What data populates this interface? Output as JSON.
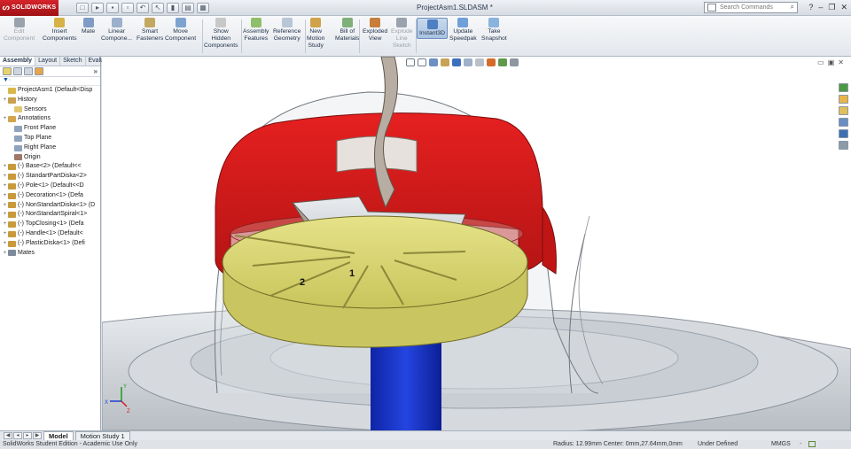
{
  "app": {
    "logo_text": "SOLIDWORKS",
    "doc_title": "ProjectAsm1.SLDASM *"
  },
  "search": {
    "placeholder": "Search Commands"
  },
  "ribbon": {
    "buttons": [
      {
        "label": "Edit\nComponent",
        "state": "disabled"
      },
      {
        "label": "Insert\nComponents",
        "state": "normal"
      },
      {
        "label": "Mate",
        "state": "normal"
      },
      {
        "label": "Linear\nCompone...",
        "state": "normal"
      },
      {
        "label": "Smart\nFasteners",
        "state": "normal"
      },
      {
        "label": "Move\nComponent",
        "state": "normal"
      },
      {
        "label": "Show\nHidden\nComponents",
        "state": "normal"
      },
      {
        "label": "Assembly\nFeatures",
        "state": "normal"
      },
      {
        "label": "Reference\nGeometry",
        "state": "normal"
      },
      {
        "label": "New\nMotion\nStudy",
        "state": "normal"
      },
      {
        "label": "Bill of\nMaterials",
        "state": "normal"
      },
      {
        "label": "Exploded\nView",
        "state": "normal"
      },
      {
        "label": "Explode\nLine\nSketch",
        "state": "disabled"
      },
      {
        "label": "Instant3D",
        "state": "active"
      },
      {
        "label": "Update\nSpeedpak",
        "state": "normal"
      },
      {
        "label": "Take\nSnapshot",
        "state": "normal"
      }
    ]
  },
  "panel": {
    "tabs": [
      "Assembly",
      "Layout",
      "Sketch",
      "Evaluate"
    ],
    "active_tab": "Assembly",
    "tree": [
      {
        "label": "ProjectAsm1  (Default<Disp",
        "level": 0,
        "icon": "assembly-icon",
        "expander": ""
      },
      {
        "label": "History",
        "level": 1,
        "icon": "history-icon",
        "expander": "+"
      },
      {
        "label": "Sensors",
        "level": 1,
        "icon": "sensors-folder-icon",
        "expander": ""
      },
      {
        "label": "Annotations",
        "level": 1,
        "icon": "annotations-icon",
        "expander": "+"
      },
      {
        "label": "Front Plane",
        "level": 1,
        "icon": "plane-icon",
        "expander": ""
      },
      {
        "label": "Top Plane",
        "level": 1,
        "icon": "plane-icon",
        "expander": ""
      },
      {
        "label": "Right Plane",
        "level": 1,
        "icon": "plane-icon",
        "expander": ""
      },
      {
        "label": "Origin",
        "level": 1,
        "icon": "origin-icon",
        "expander": ""
      },
      {
        "label": "(-) Base<2> (Default<<",
        "level": 1,
        "icon": "part-icon",
        "expander": "+"
      },
      {
        "label": "(-) StandartPartDiska<2>",
        "level": 1,
        "icon": "part-icon",
        "expander": "+"
      },
      {
        "label": "(-) Pole<1> (Default<<D",
        "level": 1,
        "icon": "part-icon",
        "expander": "+"
      },
      {
        "label": "(-) Decoration<1> (Defa",
        "level": 1,
        "icon": "part-icon",
        "expander": "+"
      },
      {
        "label": "(-) NonStandartDiska<1> (D",
        "level": 1,
        "icon": "part-icon",
        "expander": "+"
      },
      {
        "label": "(-) NonStandartSpiral<1>",
        "level": 1,
        "icon": "part-icon",
        "expander": "+"
      },
      {
        "label": "(-) TopClosing<1> (Defa",
        "level": 1,
        "icon": "part-icon",
        "expander": "+"
      },
      {
        "label": "(-) Handle<1> (Default<",
        "level": 1,
        "icon": "part-icon",
        "expander": "+"
      },
      {
        "label": "(-) PlasticDiska<1> (Defi",
        "level": 1,
        "icon": "part-icon",
        "expander": "+"
      },
      {
        "label": "Mates",
        "level": 1,
        "icon": "mates-icon",
        "expander": "+"
      }
    ]
  },
  "viewport": {
    "annotations": [
      "1",
      "2"
    ],
    "triad_labels": [
      "X",
      "Y",
      "Z"
    ]
  },
  "bottom": {
    "tabs": [
      "Model",
      "Motion Study 1"
    ],
    "active_tab": "Model"
  },
  "status": {
    "left": "SolidWorks Student Edition - Academic Use Only",
    "measure": "Radius: 12.99mm  Center: 0mm,27.64mm,0mm",
    "state": "Under Defined",
    "units": "MMGS",
    "units_arrow": "-"
  },
  "colors": {
    "red_part": "#d81b1b",
    "yellow_disk": "#d9d676",
    "blue_pole": "#1532c9",
    "gray_part": "#c7bfb5"
  }
}
